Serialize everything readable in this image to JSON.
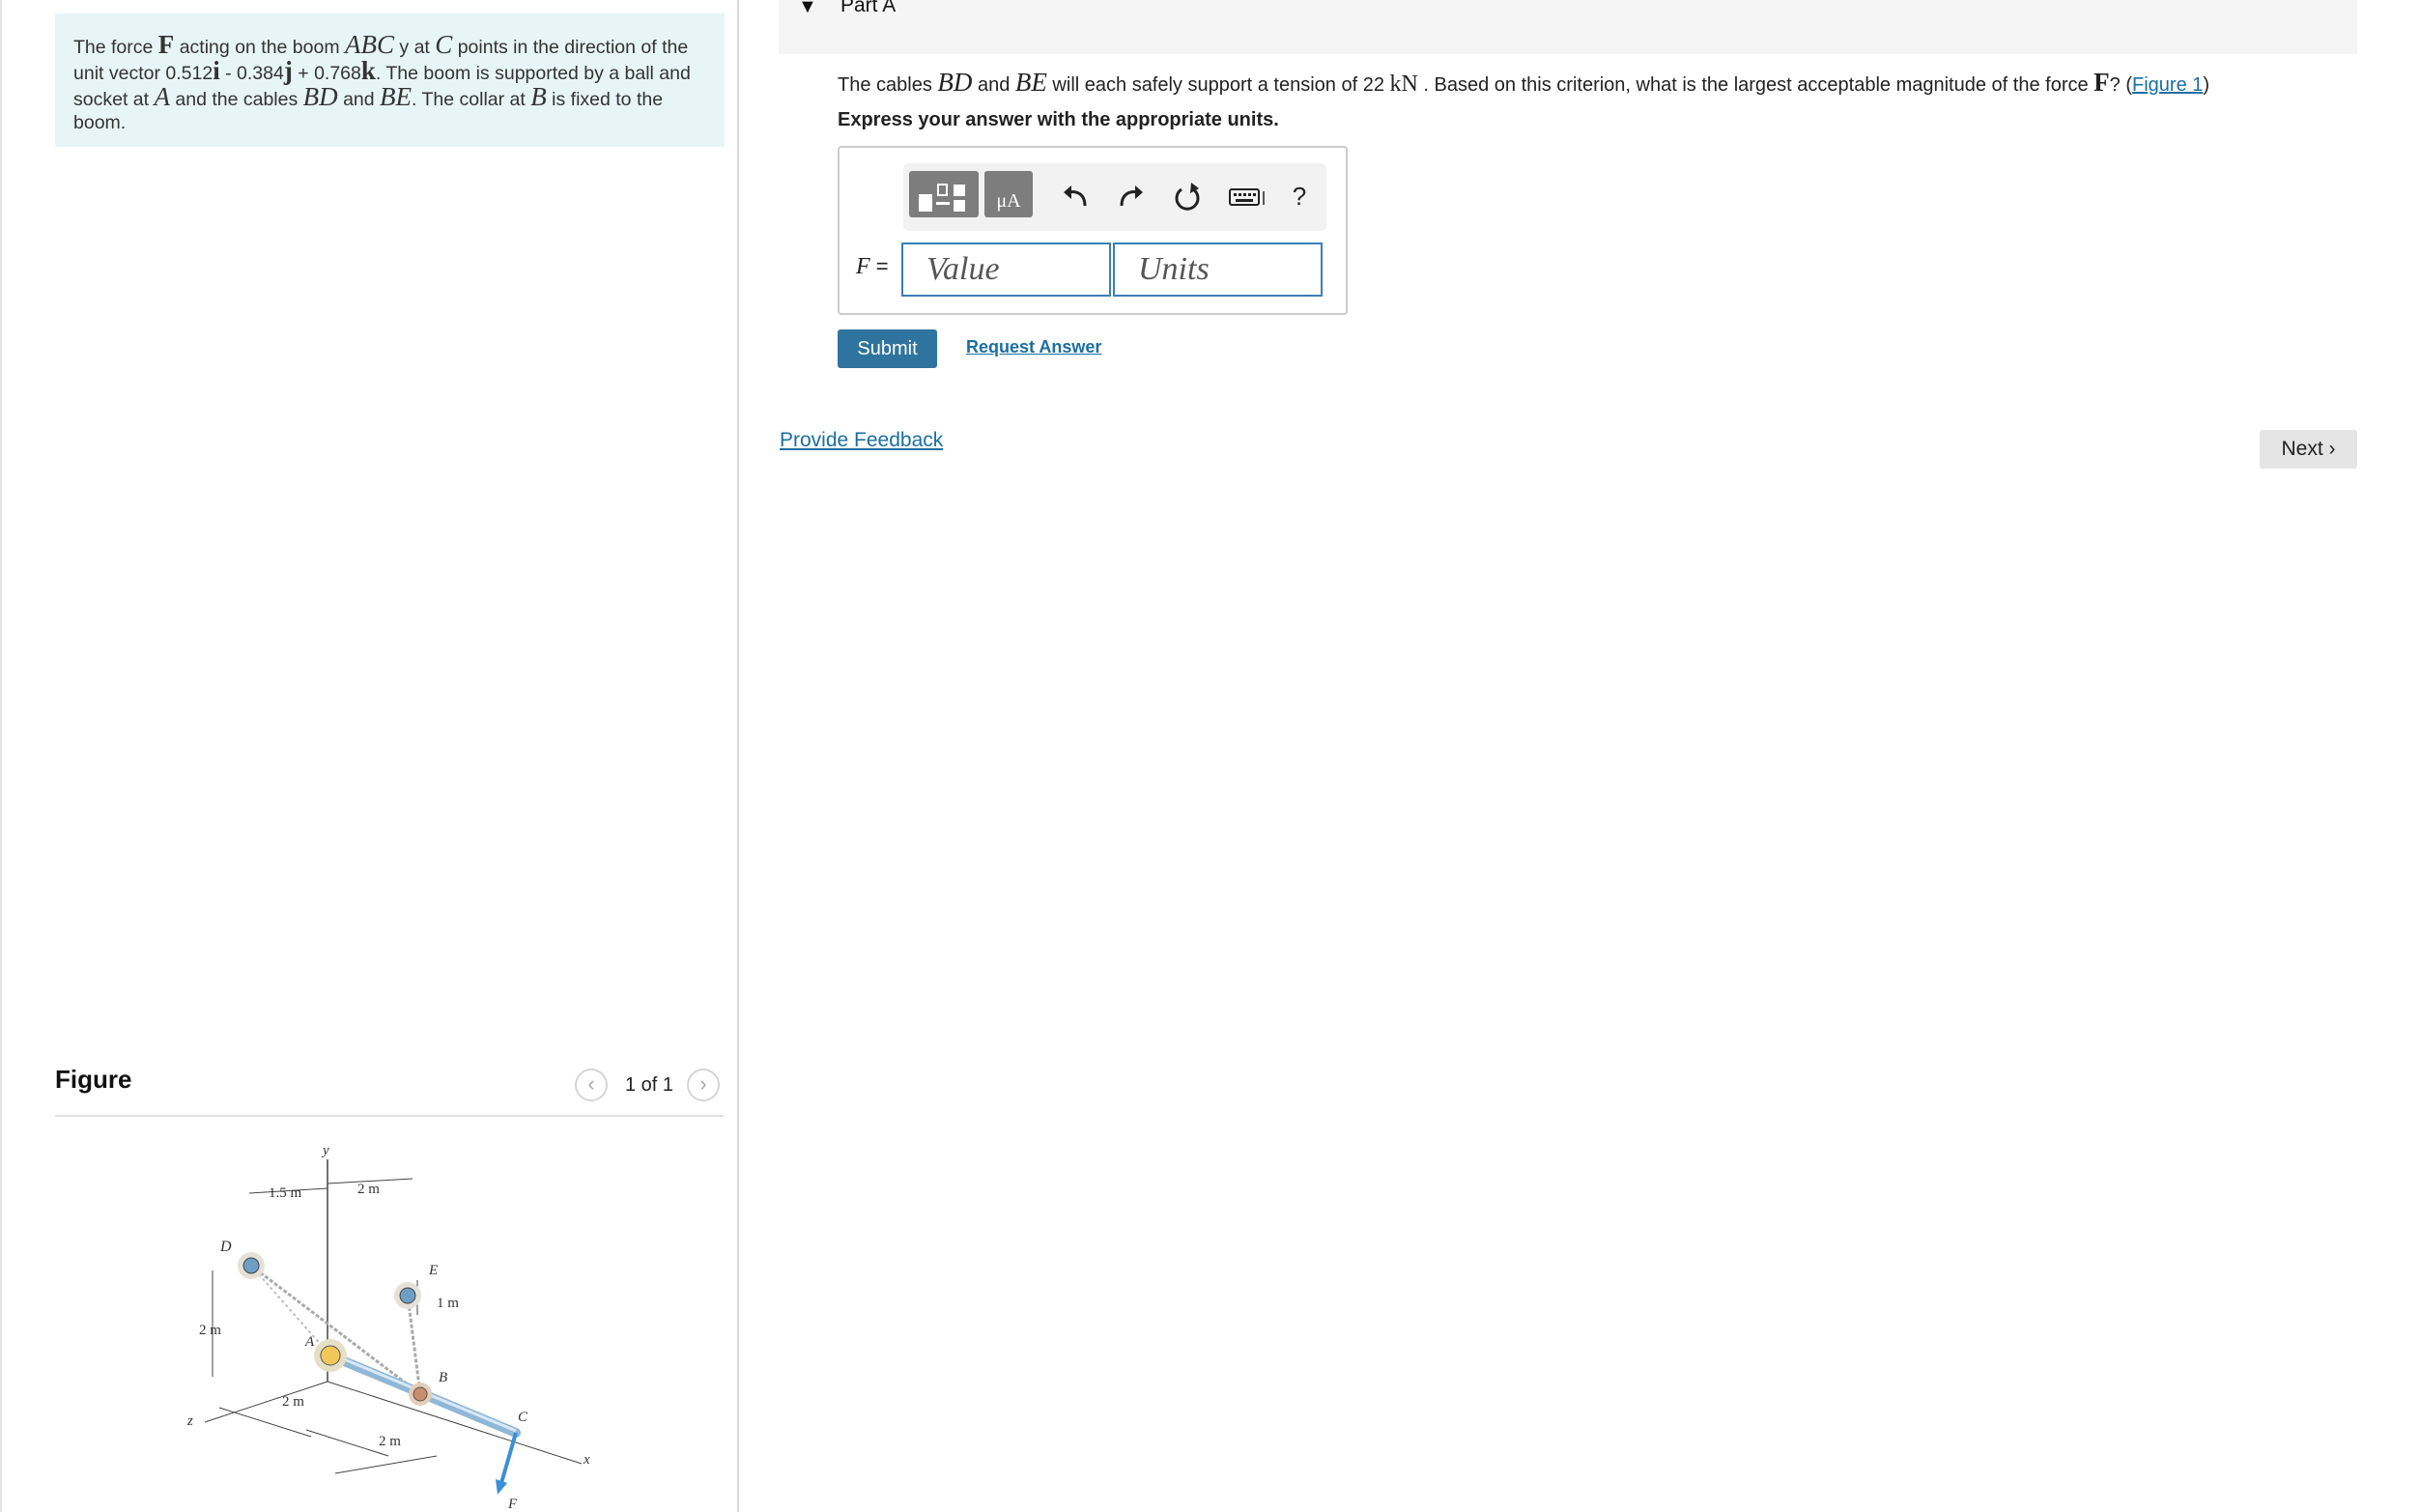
{
  "problem": {
    "t1": "The force ",
    "F": "F",
    "t2": " acting on the boom ",
    "ABC": "ABC",
    "t3": " y at ",
    "C": "C",
    "t4": " points in the direction of the unit vector 0.512",
    "i": "i",
    "t5": " - 0.384",
    "j": "j",
    "t6": " + 0.768",
    "k": "k",
    "t7": ". The boom is supported by a ball and socket at ",
    "A": "A",
    "t8": " and the cables ",
    "BD": "BD",
    "t9": " and ",
    "BE": "BE",
    "t10": ". The collar at ",
    "B": "B",
    "t11": " is fixed to the boom."
  },
  "figure": {
    "title": "Figure",
    "prev_icon": "chevron-left-icon",
    "next_icon": "chevron-right-icon",
    "pager": "1 of 1",
    "labels": {
      "y": "y",
      "x": "x",
      "z": "z",
      "D": "D",
      "E": "E",
      "A": "A",
      "B": "B",
      "C": "C",
      "F": "F",
      "d15": "1.5 m",
      "d2a": "2 m",
      "d1": "1 m",
      "d2b": "2 m",
      "d2c": "2 m",
      "d2d": "2 m"
    }
  },
  "part": {
    "caret_icon": "caret-down-icon",
    "title": "Part A",
    "q1": "The cables ",
    "BD": "BD",
    "q2": " and ",
    "BE": "BE",
    "q3": " will each safely support a tension of 22 ",
    "kN": "kN",
    "q4": " . Based on this criterion, what is the largest acceptable magnitude of the force ",
    "F": "F",
    "q5": "? (",
    "figure_link": "Figure 1",
    "q6": ")",
    "instruction": "Express your answer with the appropriate units."
  },
  "answer": {
    "toolbar_icons": [
      "templates-icon",
      "units-icon",
      "undo-icon",
      "redo-icon",
      "reset-icon",
      "keyboard-icon",
      "help-icon"
    ],
    "units_glyph": "μA",
    "help": "?",
    "label_var": "F",
    "label_eq": " =",
    "value_placeholder": "Value",
    "units_placeholder": "Units"
  },
  "actions": {
    "submit": "Submit",
    "request_answer": "Request Answer",
    "provide_feedback": "Provide Feedback",
    "next": "Next"
  }
}
